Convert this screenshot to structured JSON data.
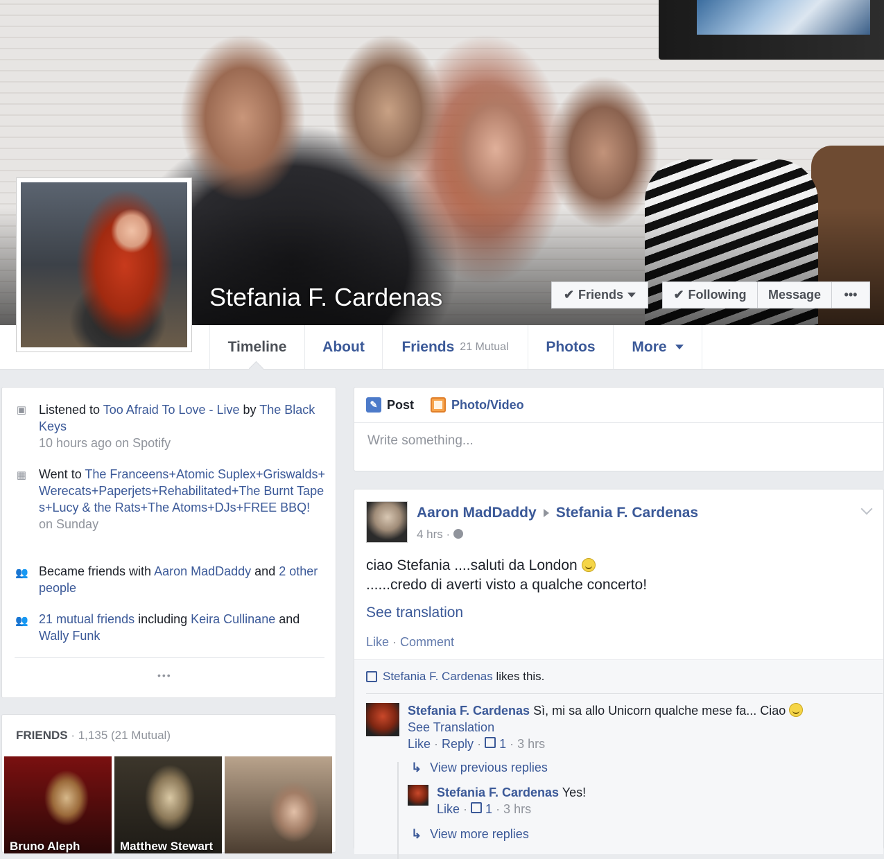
{
  "profile": {
    "name": "Stefania F. Cardenas",
    "buttons": {
      "friends": "Friends",
      "following": "Following",
      "message": "Message",
      "more": "•••"
    }
  },
  "tabs": [
    {
      "label": "Timeline"
    },
    {
      "label": "About"
    },
    {
      "label": "Friends",
      "extra": "21 Mutual"
    },
    {
      "label": "Photos"
    },
    {
      "label": "More"
    }
  ],
  "activity": [
    {
      "icon": "box-icon",
      "parts": [
        "Listened to ",
        "Too Afraid To Love - Live",
        " by ",
        "The Black Keys"
      ],
      "sub": "10 hours ago on Spotify"
    },
    {
      "icon": "calendar-icon",
      "parts": [
        "Went to ",
        "The Franceens+Atomic Suplex+Griswalds+Werecats+Paperjets+Rehabilitated+The Burnt Tapes+Lucy & the Rats+The Atoms+DJs+FREE BBQ!"
      ],
      "sub": "on Sunday"
    },
    {
      "icon": "friends-icon",
      "parts": [
        "Became friends with ",
        "Aaron MadDaddy",
        " and ",
        "2 other people"
      ]
    },
    {
      "icon": "friends-icon",
      "parts": [
        "21 mutual friends",
        " including ",
        "Keira Cullinane",
        " and ",
        "Wally Funk"
      ]
    }
  ],
  "activity_more": "•••",
  "friends_section": {
    "title": "FRIENDS",
    "count": " · 1,135 (21 Mutual)",
    "friends": [
      {
        "name": "Bruno Aleph"
      },
      {
        "name": "Matthew Stewart"
      },
      {
        "name": ""
      }
    ]
  },
  "composer": {
    "post_label": "Post",
    "photo_label": "Photo/Video",
    "placeholder": "Write something..."
  },
  "post": {
    "author": "Aaron MadDaddy",
    "target": "Stefania F. Cardenas",
    "time": "4 hrs · ",
    "line1": "ciao Stefania ....saluti da London ",
    "line2": "......credo di averti visto a qualche concerto!",
    "see_translation": "See translation",
    "like": "Like",
    "sep": " · ",
    "comment": "Comment",
    "likes_name": "Stefania F. Cardenas",
    "likes_text": " likes this."
  },
  "comments": [
    {
      "author": "Stefania F. Cardenas",
      "text": " Sì, mi sa allo Unicorn qualche mese fa... Ciao ",
      "see": "See Translation",
      "like": "Like",
      "reply": "Reply",
      "likes": "1",
      "time": " · 3 hrs"
    }
  ],
  "view_previous": "View previous replies",
  "reply": {
    "author": "Stefania F. Cardenas",
    "text": " Yes!",
    "like": "Like",
    "likes": "1",
    "time": " · 3 hrs"
  },
  "view_more": "View more replies"
}
